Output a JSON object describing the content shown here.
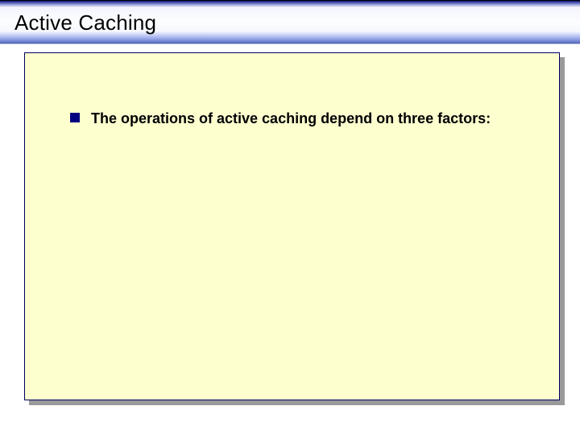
{
  "slide": {
    "title": "Active Caching",
    "bullets": [
      {
        "text": "The operations of active caching depend on three factors:"
      }
    ]
  }
}
